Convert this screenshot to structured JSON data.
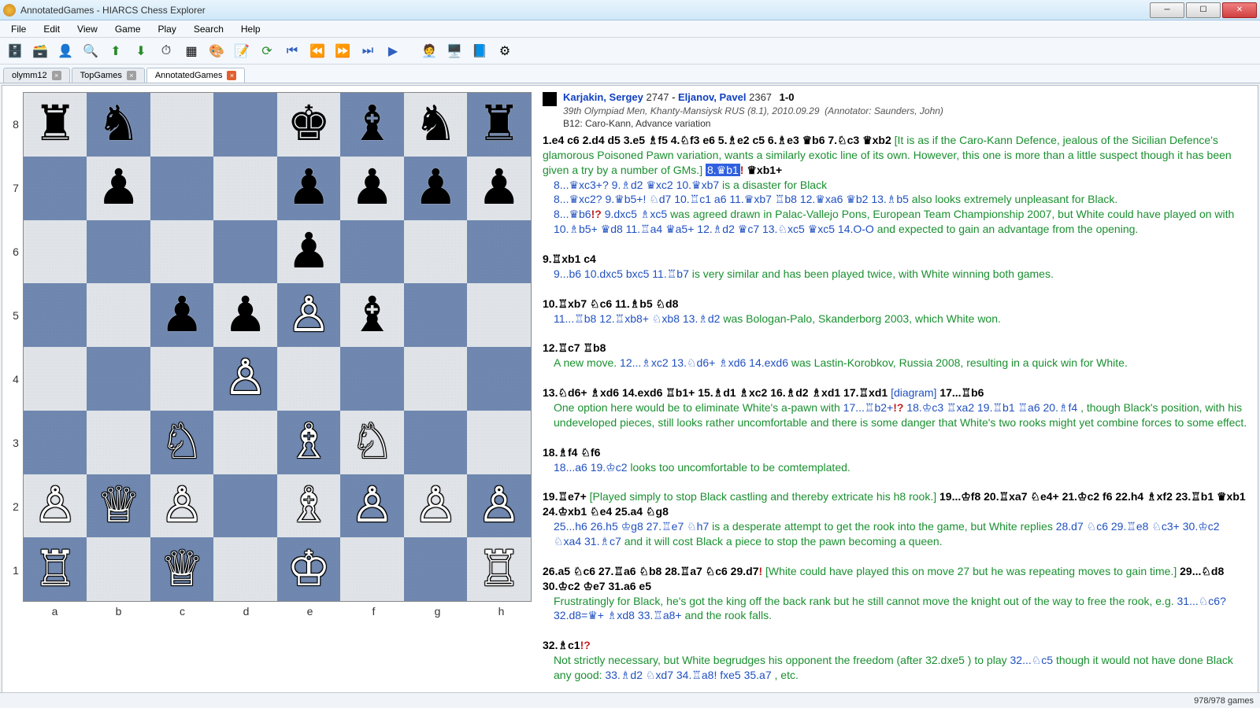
{
  "window": {
    "title": "AnnotatedGames - HIARCS Chess Explorer"
  },
  "menus": [
    "File",
    "Edit",
    "View",
    "Game",
    "Play",
    "Search",
    "Help"
  ],
  "tabs": [
    {
      "label": "olymm12",
      "active": false
    },
    {
      "label": "TopGames",
      "active": false
    },
    {
      "label": "AnnotatedGames",
      "active": true
    }
  ],
  "header": {
    "white": "Karjakin, Sergey",
    "white_elo": "2747",
    "black": "Eljanov, Pavel",
    "black_elo": "2367",
    "result": "1-0",
    "event": "39th Olympiad Men, Khanty-Mansiysk RUS (8.1), 2010.09.29",
    "annotator": "(Annotator: Saunders, John)",
    "eco": "B12: Caro-Kann, Advance variation"
  },
  "board": {
    "ranks": [
      "8",
      "7",
      "6",
      "5",
      "4",
      "3",
      "2",
      "1"
    ],
    "files": [
      "a",
      "b",
      "c",
      "d",
      "e",
      "f",
      "g",
      "h"
    ],
    "position": [
      [
        "r",
        "n",
        "",
        "",
        "k",
        "b",
        "n",
        "r"
      ],
      [
        "",
        "p",
        "",
        "",
        "p",
        "p",
        "p",
        "p"
      ],
      [
        "",
        "",
        "",
        "",
        "p",
        "",
        "",
        ""
      ],
      [
        "",
        "",
        "p",
        "p",
        "P",
        "b",
        "",
        ""
      ],
      [
        "",
        "",
        "",
        "P",
        "",
        "",
        "",
        ""
      ],
      [
        "",
        "",
        "N",
        "",
        "B",
        "N",
        "",
        ""
      ],
      [
        "P",
        "Q",
        "P",
        "",
        "B",
        "P",
        "P",
        "P"
      ],
      [
        "R",
        "",
        "Q",
        "",
        "K",
        "",
        "",
        "R"
      ]
    ]
  },
  "notation_segments": [
    {
      "t": "mv",
      "s": "1.e4 c6 2.d4 d5 3.e5 ♗f5 4.♘f3 e6 5.♗e2 c5 6.♗e3 ♛b6 7.♘c3 ♛xb2 "
    },
    {
      "t": "cm",
      "s": "[It is as if the Caro-Kann Defence, jealous of the Sicilian Defence's glamorous Poisoned Pawn variation, wants a similarly exotic line of its own. However, this one is more than a little suspect though it has been given a try by a number of GMs.] "
    },
    {
      "t": "hl",
      "s": "8.♛b1"
    },
    {
      "t": "eb",
      "s": "! "
    },
    {
      "t": "mv",
      "s": "♛xb1+"
    },
    {
      "t": "br"
    },
    {
      "t": "indent_open"
    },
    {
      "t": "va",
      "s": "8...♛xc3+? "
    },
    {
      "t": "vb",
      "s": "9.♗d2 ♛xc2 10.♛xb7 "
    },
    {
      "t": "cm",
      "s": "is a disaster for Black"
    },
    {
      "t": "br"
    },
    {
      "t": "va",
      "s": "8...♛xc2? "
    },
    {
      "t": "vb",
      "s": "9.♛b5+! ♘d7 10.♖c1 a6 11.♛xb7 ♖b8 12.♛xa6 ♛b2 13.♗b5 "
    },
    {
      "t": "cm",
      "s": "also looks extremely unpleasant for Black."
    },
    {
      "t": "br"
    },
    {
      "t": "va",
      "s": "8...♛b6"
    },
    {
      "t": "eb",
      "s": "!? "
    },
    {
      "t": "vb",
      "s": "9.dxc5 ♗xc5 "
    },
    {
      "t": "cm",
      "s": "was agreed drawn in Palac-Vallejo Pons, European Team Championship 2007, but White could have played on with "
    },
    {
      "t": "vb",
      "s": "10.♗b5+ ♛d8 11.♖a4 ♛a5+ 12.♗d2 ♛c7 13.♘xc5 ♛xc5 14.O-O "
    },
    {
      "t": "cm",
      "s": "and expected to gain an advantage from the opening."
    },
    {
      "t": "indent_close"
    },
    {
      "t": "br"
    },
    {
      "t": "mv",
      "s": "9.♖xb1 c4"
    },
    {
      "t": "br"
    },
    {
      "t": "indent_open"
    },
    {
      "t": "vb",
      "s": "9...b6 10.dxc5 bxc5 11.♖b7 "
    },
    {
      "t": "cm",
      "s": "is very similar and has been played twice, with White winning both games."
    },
    {
      "t": "indent_close"
    },
    {
      "t": "br"
    },
    {
      "t": "mv",
      "s": "10.♖xb7 ♘c6 11.♗b5 ♘d8"
    },
    {
      "t": "br"
    },
    {
      "t": "indent_open"
    },
    {
      "t": "vb",
      "s": "11...♖b8 12.♖xb8+ ♘xb8 13.♗d2 "
    },
    {
      "t": "cm",
      "s": "was Bologan-Palo, Skanderborg 2003, which White won."
    },
    {
      "t": "indent_close"
    },
    {
      "t": "br"
    },
    {
      "t": "mv",
      "s": "12.♖c7 ♖b8"
    },
    {
      "t": "br"
    },
    {
      "t": "indent_open"
    },
    {
      "t": "cm",
      "s": "A new move. "
    },
    {
      "t": "vb",
      "s": "12...♗xc2 13.♘d6+ ♗xd6 14.exd6 "
    },
    {
      "t": "cm",
      "s": "was Lastin-Korobkov, Russia 2008, resulting in a quick win for White."
    },
    {
      "t": "indent_close"
    },
    {
      "t": "br"
    },
    {
      "t": "mv",
      "s": "13.♘d6+ ♗xd6 14.exd6 ♖b1+ 15.♗d1 ♗xc2 16.♗d2 ♗xd1 17.♖xd1 "
    },
    {
      "t": "diag",
      "s": "[diagram] "
    },
    {
      "t": "mv",
      "s": "17...♖b6"
    },
    {
      "t": "br"
    },
    {
      "t": "indent_open"
    },
    {
      "t": "cm",
      "s": "One option here would be to eliminate White's a-pawn with "
    },
    {
      "t": "vb",
      "s": "17...♖b2+"
    },
    {
      "t": "eb",
      "s": "!? "
    },
    {
      "t": "vb",
      "s": "18.♔c3 ♖xa2 19.♖b1 ♖a6 20.♗f4 "
    },
    {
      "t": "cm",
      "s": ", though Black's position, with his undeveloped pieces, still looks rather uncomfortable and there is some danger that White's two rooks might yet combine forces to some effect."
    },
    {
      "t": "indent_close"
    },
    {
      "t": "br"
    },
    {
      "t": "mv",
      "s": "18.♗f4 ♘f6"
    },
    {
      "t": "br"
    },
    {
      "t": "indent_open"
    },
    {
      "t": "vb",
      "s": "18...a6 19.♔c2 "
    },
    {
      "t": "cm",
      "s": "looks too uncomfortable to be comtemplated."
    },
    {
      "t": "indent_close"
    },
    {
      "t": "br"
    },
    {
      "t": "mv",
      "s": "19.♖e7+ "
    },
    {
      "t": "cm",
      "s": "[Played simply to stop Black castling and thereby extricate his h8 rook.] "
    },
    {
      "t": "mv",
      "s": "19...♔f8 20.♖xa7 ♘e4+ 21.♔c2 f6 22.h4 ♗xf2 23.♖b1 ♛xb1 24.♔xb1 ♘e4 25.a4 ♘g8"
    },
    {
      "t": "br"
    },
    {
      "t": "indent_open"
    },
    {
      "t": "vb",
      "s": "25...h6 26.h5 ♔g8 27.♖e7 ♘h7 "
    },
    {
      "t": "cm",
      "s": "is a desperate attempt to get the rook into the game, but White replies "
    },
    {
      "t": "vb",
      "s": "28.d7 ♘c6 29.♖e8 ♘c3+ 30.♔c2 ♘xa4 31.♗c7 "
    },
    {
      "t": "cm",
      "s": "and it will cost Black a piece to stop the pawn becoming a queen."
    },
    {
      "t": "indent_close"
    },
    {
      "t": "br"
    },
    {
      "t": "mv",
      "s": "26.a5 ♘c6 27.♖a6 ♘b8 28.♖a7 ♘c6 29.d7"
    },
    {
      "t": "eb",
      "s": "! "
    },
    {
      "t": "cm",
      "s": "[White could have played this on move 27 but he was repeating moves to gain time.] "
    },
    {
      "t": "mv",
      "s": "29...♘d8 30.♔c2 ♔e7 31.a6 e5"
    },
    {
      "t": "br"
    },
    {
      "t": "indent_open"
    },
    {
      "t": "cm",
      "s": "Frustratingly for Black, he's got the king off the back rank but he still cannot move the knight out of the way to free the rook, e.g. "
    },
    {
      "t": "vb",
      "s": "31...♘c6? 32.d8=♛+ ♗xd8 33.♖a8+ "
    },
    {
      "t": "cm",
      "s": "and the rook falls."
    },
    {
      "t": "indent_close"
    },
    {
      "t": "br"
    },
    {
      "t": "mv",
      "s": "32.♗c1"
    },
    {
      "t": "eb",
      "s": "!?"
    },
    {
      "t": "br"
    },
    {
      "t": "indent_open"
    },
    {
      "t": "cm",
      "s": "Not strictly necessary, but White begrudges his opponent the freedom (after 32.dxe5 ) to play "
    },
    {
      "t": "vb",
      "s": "32...♘c5 "
    },
    {
      "t": "cm",
      "s": "though it would not have done Black any good: "
    },
    {
      "t": "vb",
      "s": "33.♗d2 ♘xd7 34.♖a8! fxe5 35.a7 "
    },
    {
      "t": "cm",
      "s": ", etc."
    },
    {
      "t": "indent_close"
    }
  ],
  "status": {
    "games": "978/978 games"
  },
  "toolbar_icons": [
    "db-new",
    "db-open",
    "user",
    "search",
    "up",
    "down",
    "clock",
    "board",
    "palette",
    "edit",
    "refresh",
    "first",
    "prev",
    "next",
    "last",
    "play",
    "advisor",
    "engine",
    "book",
    "settings"
  ]
}
